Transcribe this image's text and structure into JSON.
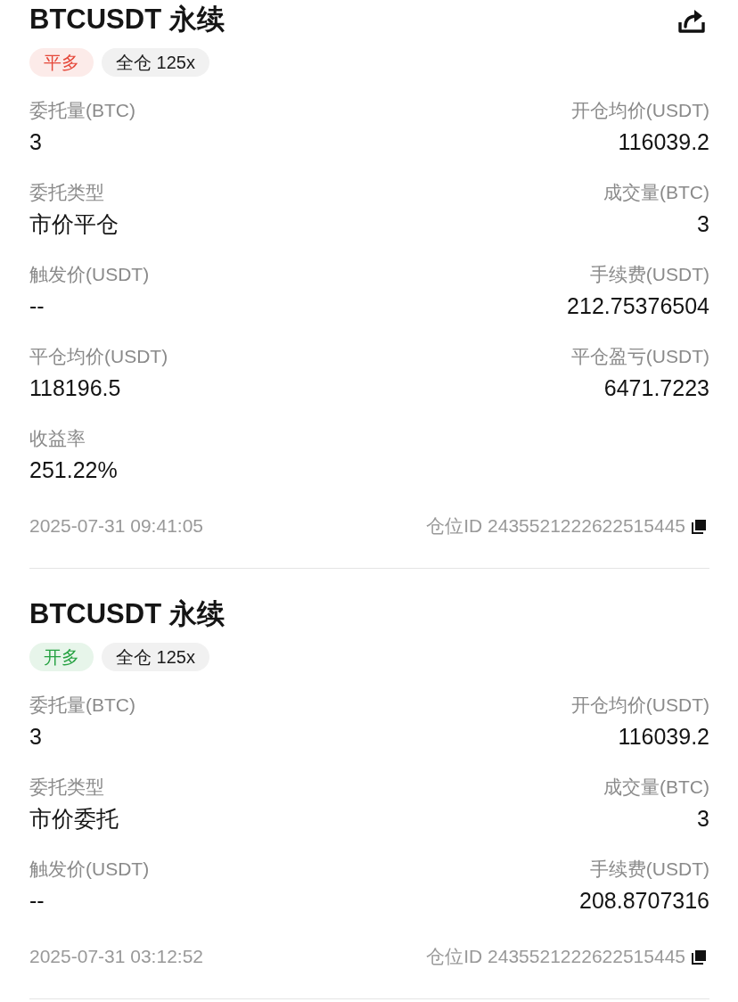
{
  "orders": [
    {
      "title": "BTCUSDT 永续",
      "share_button": true,
      "tags": [
        {
          "label": "平多",
          "kind": "direction",
          "color": "#e5483a"
        },
        {
          "label": "全仓 125x",
          "kind": "margin"
        }
      ],
      "fields": [
        {
          "label": "委托量(BTC)",
          "value": "3"
        },
        {
          "label": "开仓均价(USDT)",
          "value": "116039.2"
        },
        {
          "label": "委托类型",
          "value": "市价平仓"
        },
        {
          "label": "成交量(BTC)",
          "value": "3"
        },
        {
          "label": "触发价(USDT)",
          "value": "--"
        },
        {
          "label": "手续费(USDT)",
          "value": "212.75376504"
        },
        {
          "label": "平仓均价(USDT)",
          "value": "118196.5"
        },
        {
          "label": "平仓盈亏(USDT)",
          "value": "6471.7223"
        },
        {
          "label": "收益率",
          "value": "251.22%"
        }
      ],
      "time": "2025-07-31 09:41:05",
      "position_id": "仓位ID 2435521222622515445"
    },
    {
      "title": "BTCUSDT 永续",
      "share_button": false,
      "tags": [
        {
          "label": "开多",
          "kind": "direction",
          "color": "#27a243"
        },
        {
          "label": "全仓 125x",
          "kind": "margin"
        }
      ],
      "fields": [
        {
          "label": "委托量(BTC)",
          "value": "3"
        },
        {
          "label": "开仓均价(USDT)",
          "value": "116039.2"
        },
        {
          "label": "委托类型",
          "value": "市价委托"
        },
        {
          "label": "成交量(BTC)",
          "value": "3"
        },
        {
          "label": "触发价(USDT)",
          "value": "--"
        },
        {
          "label": "手续费(USDT)",
          "value": "208.8707316"
        }
      ],
      "time": "2025-07-31 03:12:52",
      "position_id": "仓位ID 2435521222622515445"
    }
  ]
}
